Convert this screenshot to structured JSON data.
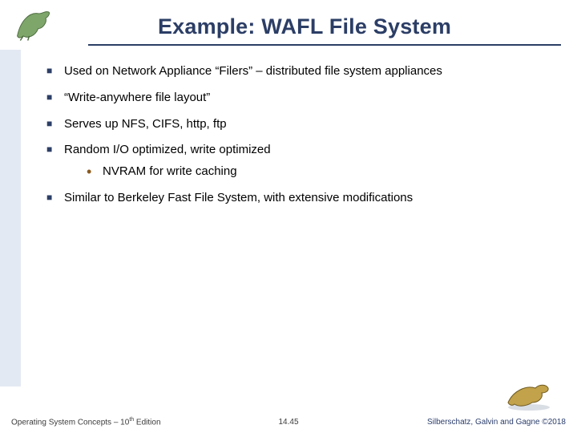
{
  "title": "Example: WAFL File System",
  "bullets": [
    {
      "text": "Used on Network Appliance “Filers” – distributed file system appliances"
    },
    {
      "text": "“Write-anywhere file layout”"
    },
    {
      "text": "Serves up NFS, CIFS, http, ftp"
    },
    {
      "text": "Random I/O optimized, write optimized",
      "sub": [
        {
          "text": "NVRAM for write caching"
        }
      ]
    },
    {
      "text": "Similar to Berkeley Fast File System, with extensive modifications"
    }
  ],
  "footer": {
    "left_prefix": "Operating System Concepts – 10",
    "left_suffix": " Edition",
    "left_sup": "th",
    "center": "14.45",
    "right": "Silberschatz, Galvin and Gagne ©2018"
  },
  "icons": {
    "top_dino": "dinosaur-icon",
    "bottom_dino": "dinosaur-icon"
  }
}
